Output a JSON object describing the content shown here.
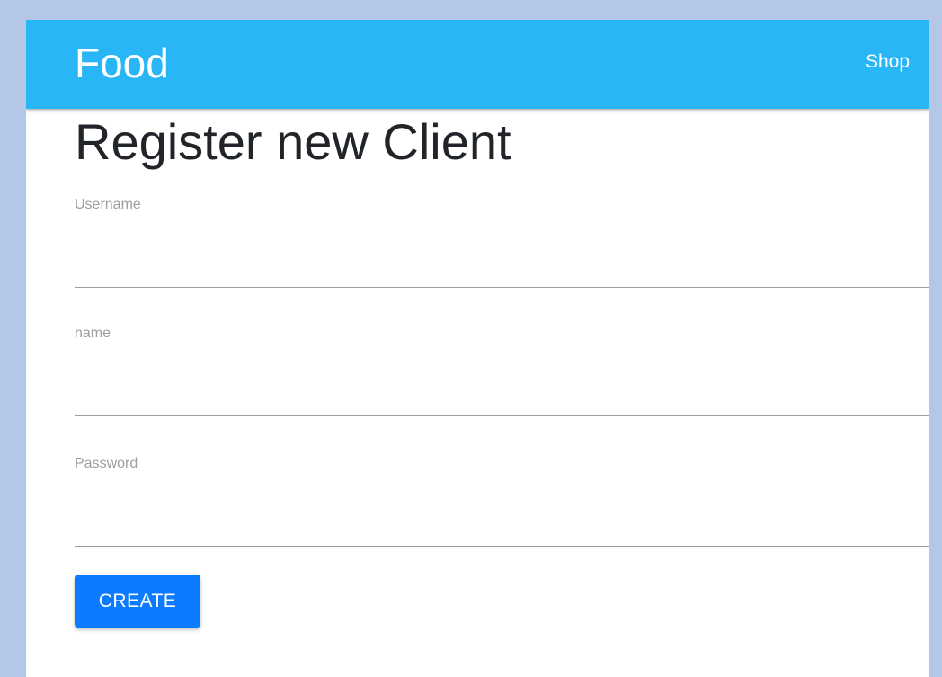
{
  "header": {
    "brand": "Food",
    "nav_link": "Shop"
  },
  "page": {
    "title": "Register new Client"
  },
  "form": {
    "fields": [
      {
        "label": "Username",
        "value": "",
        "placeholder": ""
      },
      {
        "label": "name",
        "value": "",
        "placeholder": ""
      },
      {
        "label": "Password",
        "value": "",
        "placeholder": ""
      }
    ],
    "submit_label": "CREATE"
  },
  "colors": {
    "background": "#b4c7e7",
    "appbar": "#29b6f6",
    "button": "#0d7bff",
    "label": "#9e9e9e",
    "title": "#212529"
  }
}
